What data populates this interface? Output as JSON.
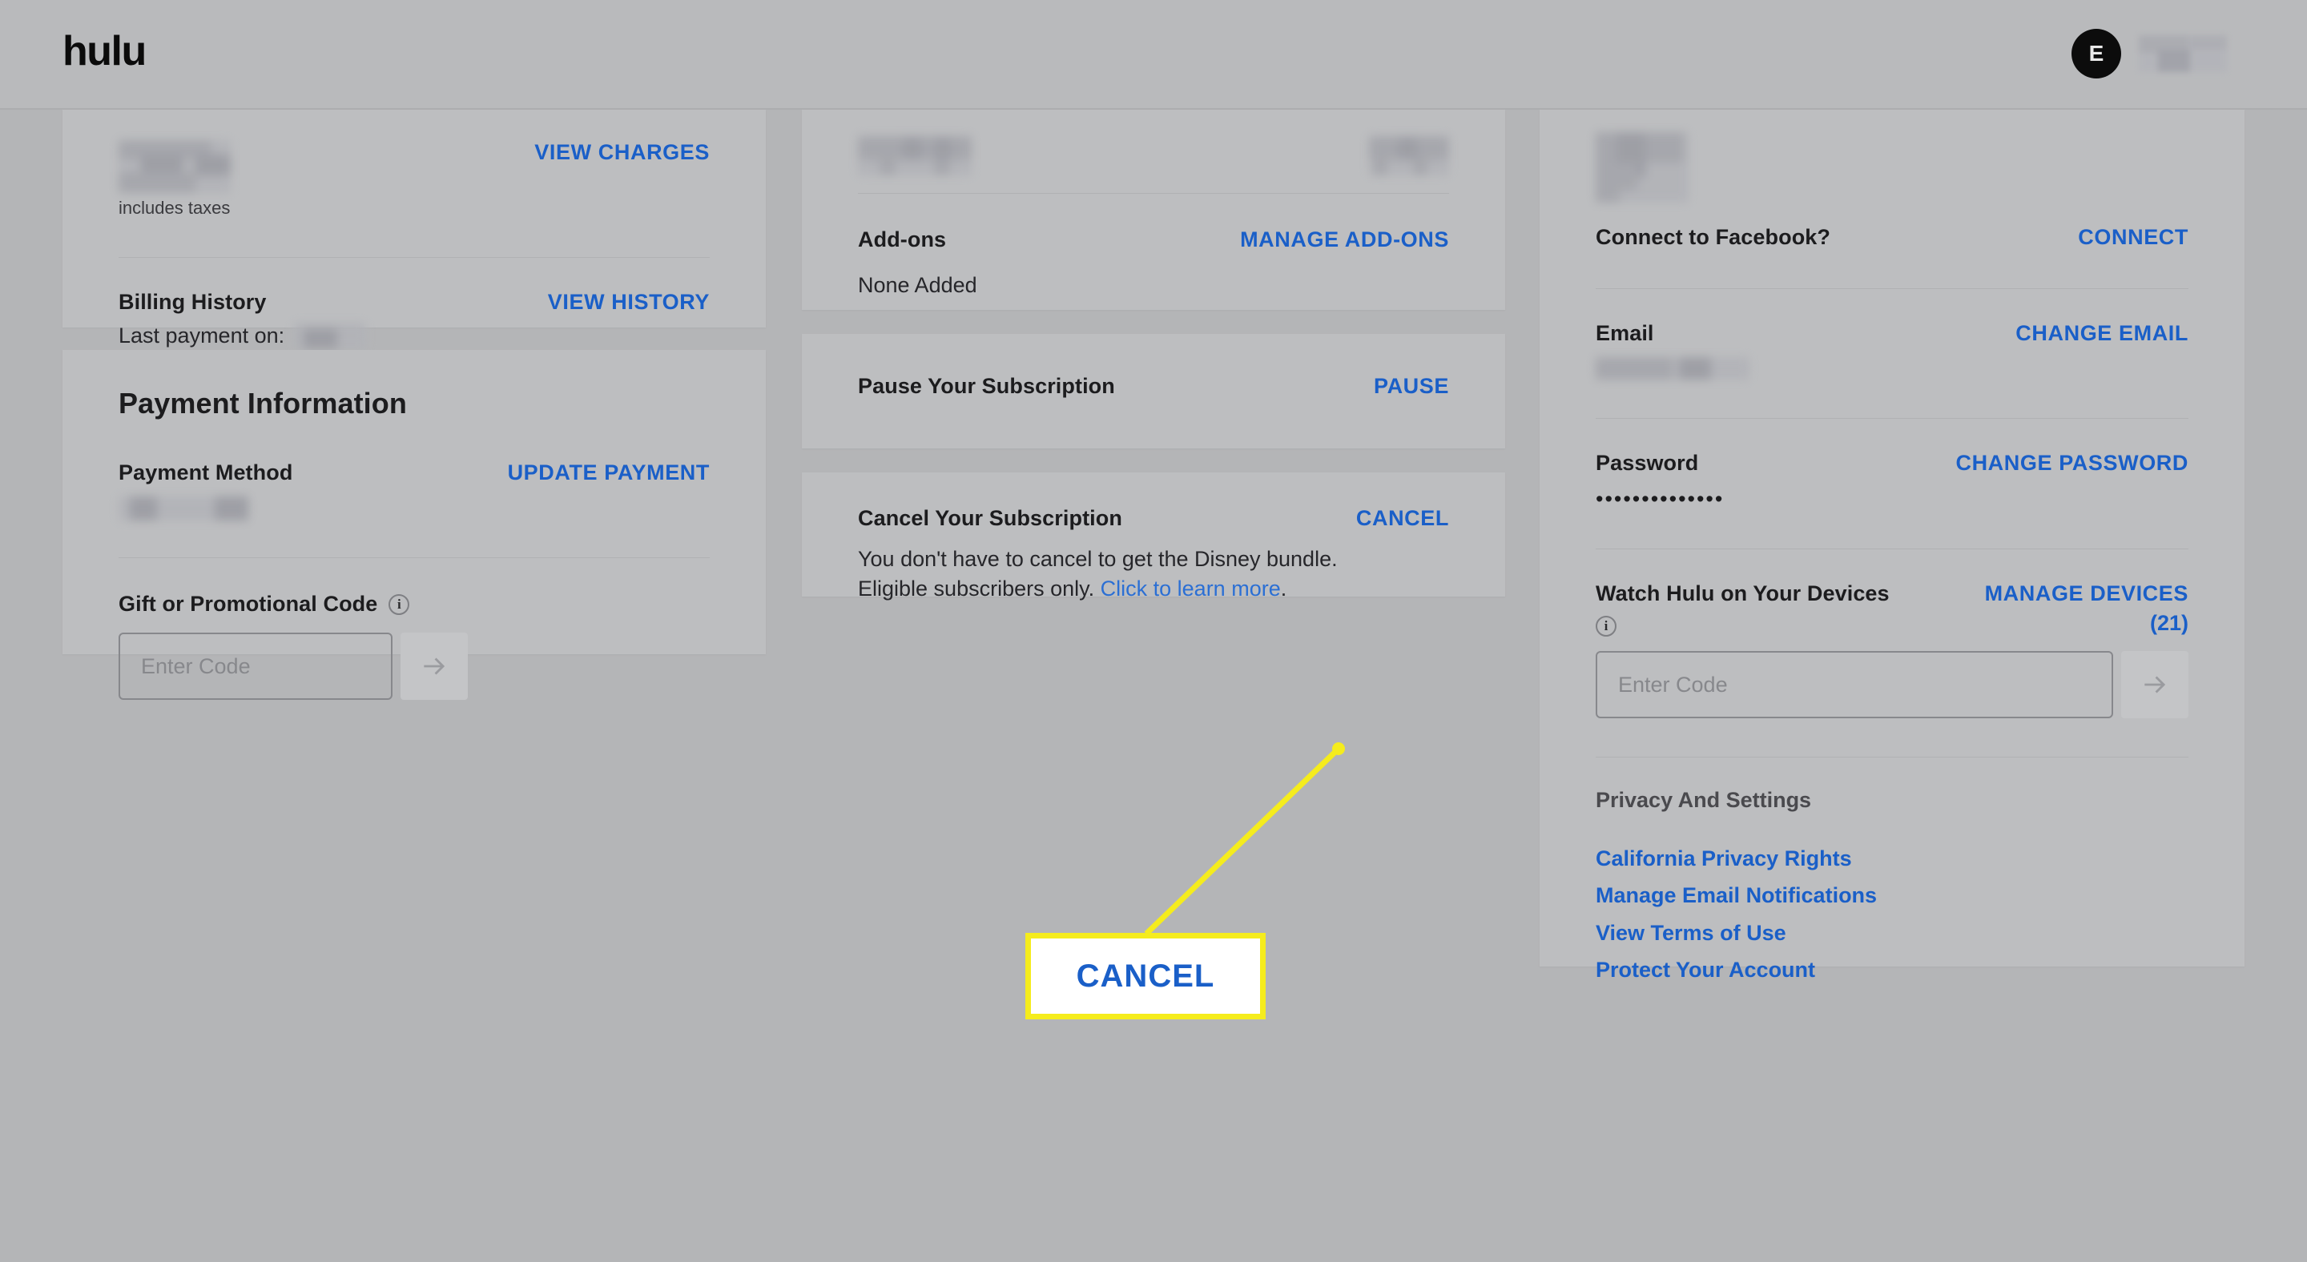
{
  "header": {
    "logo": "hulu",
    "avatar_initial": "E"
  },
  "billing_card": {
    "view_charges_label": "VIEW CHARGES",
    "includes_taxes": "includes taxes",
    "billing_history_label": "Billing History",
    "view_history_label": "VIEW HISTORY",
    "last_payment_label": "Last payment on:"
  },
  "payment_card": {
    "title": "Payment Information",
    "payment_method_label": "Payment Method",
    "update_payment_label": "UPDATE PAYMENT",
    "promo_label": "Gift or Promotional Code",
    "promo_info_icon": "info-icon",
    "promo_placeholder": "Enter Code",
    "promo_submit_icon": "arrow-right-icon"
  },
  "subscription_card": {
    "addons_label": "Add-ons",
    "manage_addons_label": "MANAGE ADD-ONS",
    "addons_value": "None Added"
  },
  "pause_card": {
    "title": "Pause Your Subscription",
    "action_label": "PAUSE"
  },
  "cancel_card": {
    "title": "Cancel Your Subscription",
    "action_label": "CANCEL",
    "body_line1": "You don't have to cancel to get the Disney bundle.",
    "body_line2_prefix": "Eligible subscribers only. ",
    "body_link": "Click to learn more",
    "body_line2_suffix": "."
  },
  "account_card": {
    "facebook_label": "Connect to Facebook?",
    "facebook_action": "CONNECT",
    "email_label": "Email",
    "email_action": "CHANGE EMAIL",
    "password_label": "Password",
    "password_action": "CHANGE PASSWORD",
    "password_masked": "••••••••••••••",
    "devices_label": "Watch Hulu on Your Devices",
    "devices_info_icon": "info-icon",
    "devices_action": "MANAGE DEVICES",
    "devices_count": "(21)",
    "devices_placeholder": "Enter Code",
    "devices_submit_icon": "arrow-right-icon"
  },
  "privacy": {
    "title": "Privacy And Settings",
    "links": [
      "California Privacy Rights",
      "Manage Email Notifications",
      "View Terms of Use",
      "Protect Your Account"
    ]
  },
  "annotation": {
    "callout_label": "CANCEL",
    "line_color": "#f5ec1d",
    "box_border_color": "#f5ec1d",
    "box_text_color": "#1a5fc8"
  },
  "colors": {
    "page_background": "#b4b5b7",
    "card_background": "#bdbec0",
    "link_blue": "#1a5fc8",
    "text_dark": "#1c1c1e",
    "highlight_yellow": "#f5ec1d"
  }
}
